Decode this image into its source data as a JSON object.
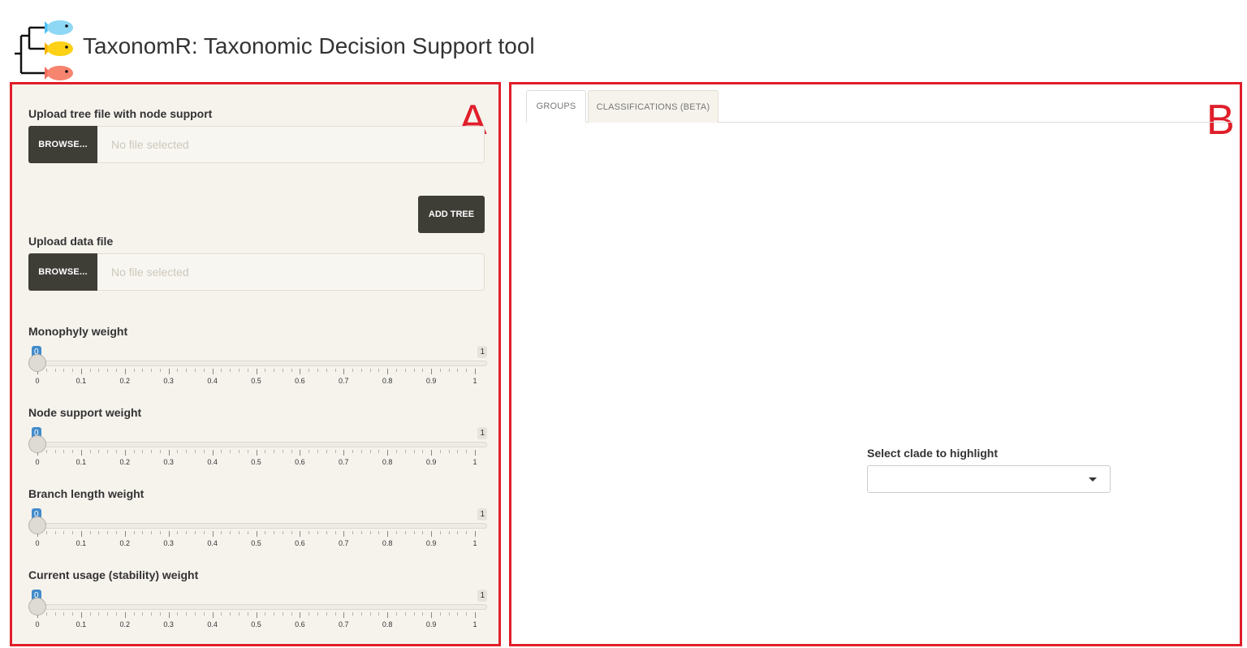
{
  "header": {
    "title": "TaxonomR: Taxonomic Decision Support tool"
  },
  "panel_letters": {
    "a": "A",
    "b": "B"
  },
  "sidebar": {
    "tree_upload": {
      "label": "Upload tree file with node support",
      "browse_label": "BROWSE...",
      "placeholder": "No file selected"
    },
    "add_tree_label": "ADD TREE",
    "data_upload": {
      "label": "Upload data file",
      "browse_label": "BROWSE...",
      "placeholder": "No file selected"
    },
    "sliders": [
      {
        "label": "Monophyly weight",
        "value": "0",
        "max": "1",
        "fraction": 0
      },
      {
        "label": "Node support weight",
        "value": "0",
        "max": "1",
        "fraction": 0
      },
      {
        "label": "Branch length weight",
        "value": "0",
        "max": "1",
        "fraction": 0
      },
      {
        "label": "Current usage (stability) weight",
        "value": "0",
        "max": "1",
        "fraction": 0
      }
    ],
    "tick_labels": [
      "0",
      "0.1",
      "0.2",
      "0.3",
      "0.4",
      "0.5",
      "0.6",
      "0.7",
      "0.8",
      "0.9",
      "1"
    ]
  },
  "main": {
    "tabs": [
      {
        "label": "GROUPS",
        "active": true
      },
      {
        "label": "CLASSIFICATIONS (BETA)",
        "active": false
      }
    ],
    "clade_select": {
      "label": "Select clade to highlight",
      "value": ""
    }
  },
  "colors": {
    "highlight_border": "#e01e2a",
    "dark_button": "#3e3d36",
    "slider_badge": "#428bca",
    "panel_bg": "#f6f3ed"
  }
}
